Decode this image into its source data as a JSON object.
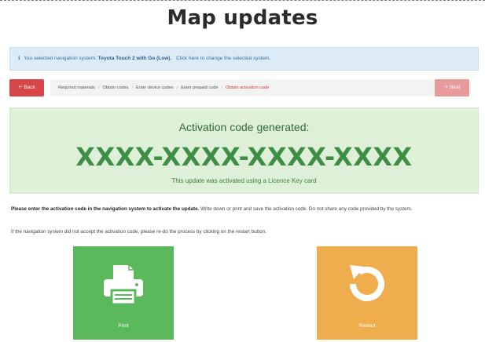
{
  "page": {
    "title": "Map updates"
  },
  "info": {
    "prefix": "You selected navigation system:",
    "system": "Toyota Touch 2 with Go (Low).",
    "change_link": "Click here to change the selected system."
  },
  "nav": {
    "back_label": "Back",
    "next_label": "Next"
  },
  "steps": [
    {
      "label": "Required materials"
    },
    {
      "label": "Obtain codes"
    },
    {
      "label": "Enter device codes"
    },
    {
      "label": "Enter prepaid code"
    },
    {
      "label": "Obtain activation code"
    }
  ],
  "activation": {
    "heading": "Activation code generated:",
    "code": "XXXX-XXXX-XXXX-XXXX",
    "note": "This update was activated using a Licence Key card"
  },
  "instructions": {
    "bold": "Please enter the activation code in the navigation system to activate the update.",
    "rest": " Write down or print and save the activation code. Do not share any code provided by the system.",
    "retry": "If the navigation system did not accept the activation code, please re-do the process by clicking on the restart button."
  },
  "actions": {
    "print_label": "Print",
    "restart_label": "Restart"
  },
  "colors": {
    "accent_red": "#d7464a",
    "success_green": "#5cb85c",
    "warning_orange": "#f0ad4e",
    "info_blue": "#dcebf6",
    "code_green": "#3f8e45"
  },
  "icons": {
    "info": "info-icon",
    "back": "arrow-left-icon",
    "next": "arrow-right-icon",
    "print": "printer-icon",
    "restart": "restart-icon"
  }
}
